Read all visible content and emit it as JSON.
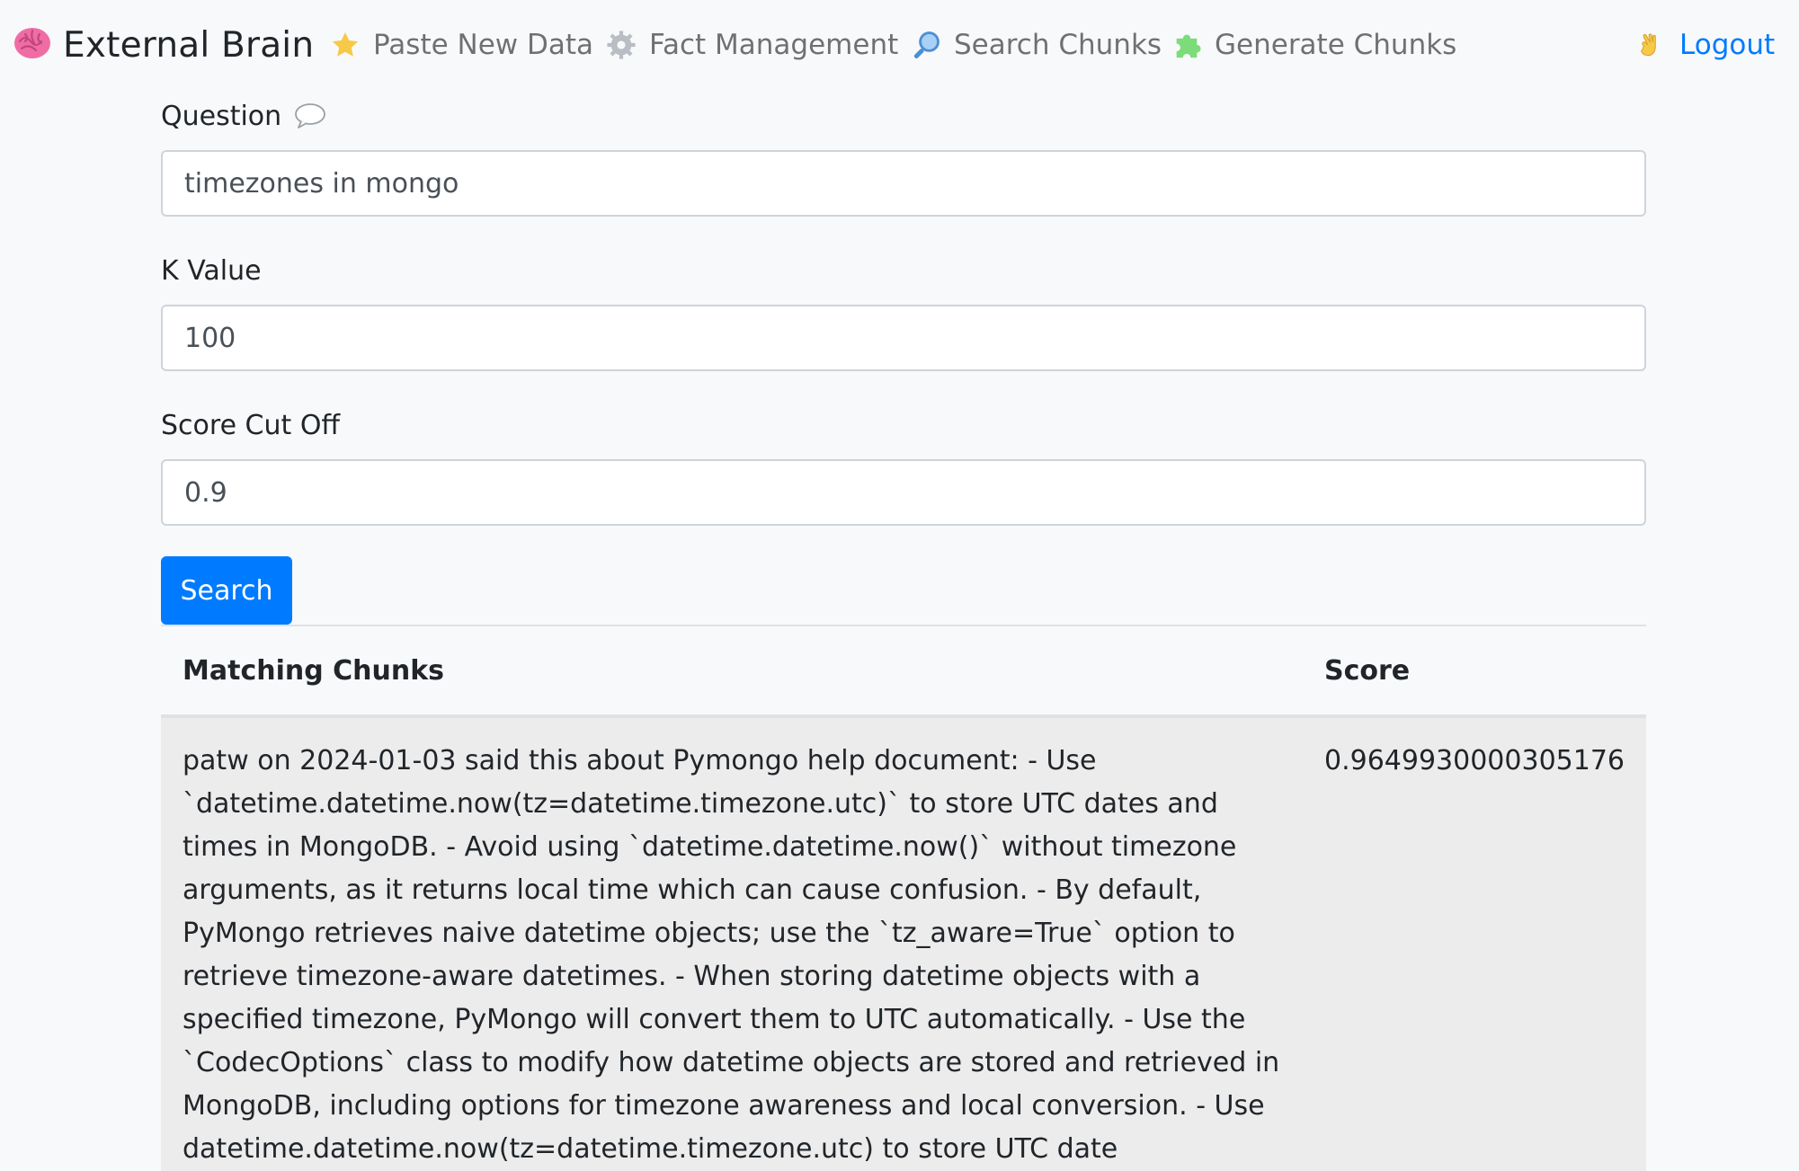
{
  "navbar": {
    "brand": {
      "icon": "brain-icon",
      "title": "External Brain"
    },
    "items": [
      {
        "icon": "star-icon",
        "label": "Paste New Data"
      },
      {
        "icon": "gear-icon",
        "label": "Fact Management"
      },
      {
        "icon": "magnifier-icon",
        "label": "Search Chunks"
      },
      {
        "icon": "puzzle-icon",
        "label": "Generate Chunks"
      }
    ],
    "logout": {
      "icon": "waving-hand-icon",
      "label": "Logout",
      "color": "#007bff"
    }
  },
  "form": {
    "question": {
      "label": "Question",
      "icon": "speech-bubble-icon",
      "value": "timezones in mongo"
    },
    "k_value": {
      "label": "K Value",
      "value": "100"
    },
    "score_cutoff": {
      "label": "Score Cut Off",
      "value": "0.9"
    },
    "search_button": "Search",
    "accent_color": "#007bff"
  },
  "results": {
    "headers": {
      "chunk": "Matching Chunks",
      "score": "Score"
    },
    "rows": [
      {
        "chunk": "patw on 2024-01-03 said this about Pymongo help document: - Use `datetime.datetime.now(tz=datetime.timezone.utc)` to store UTC dates and times in MongoDB. - Avoid using `datetime.datetime.now()` without timezone arguments, as it returns local time which can cause confusion. - By default, PyMongo retrieves naive datetime objects; use the `tz_aware=True` option to retrieve timezone-aware datetimes. - When storing datetime objects with a specified timezone, PyMongo will convert them to UTC automatically. - Use the `CodecOptions` class to modify how datetime objects are stored and retrieved in MongoDB, including options for timezone awareness and local conversion. - Use datetime.datetime.now(tz=datetime.timezone.utc) to store UTC date",
        "score": "0.9649930000305176"
      }
    ]
  }
}
